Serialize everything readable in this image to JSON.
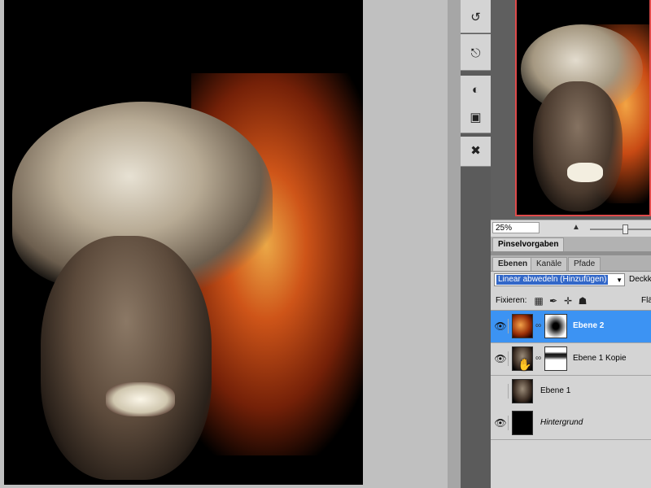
{
  "navigator": {
    "zoom": "25%"
  },
  "panels": {
    "brush_presets_tab": "Pinselvorgaben",
    "layers_tabs": [
      "Ebenen",
      "Kanäle",
      "Pfade"
    ]
  },
  "layers_panel": {
    "blend_mode": "Linear abwedeln (Hinzufügen)",
    "opacity_label": "Deckk",
    "lock_label": "Fixieren:",
    "fill_label": "Flä",
    "layers": [
      {
        "name": "Ebene 2",
        "visible": true,
        "selected": true
      },
      {
        "name": "Ebene 1 Kopie",
        "visible": true,
        "selected": false
      },
      {
        "name": "Ebene 1",
        "visible": false,
        "selected": false
      },
      {
        "name": "Hintergrund",
        "visible": true,
        "selected": false
      }
    ]
  },
  "tool_icons": [
    "history-icon",
    "clone-source-icon",
    "adjustments-icon",
    "masks-icon",
    "tools-preset-icon"
  ]
}
